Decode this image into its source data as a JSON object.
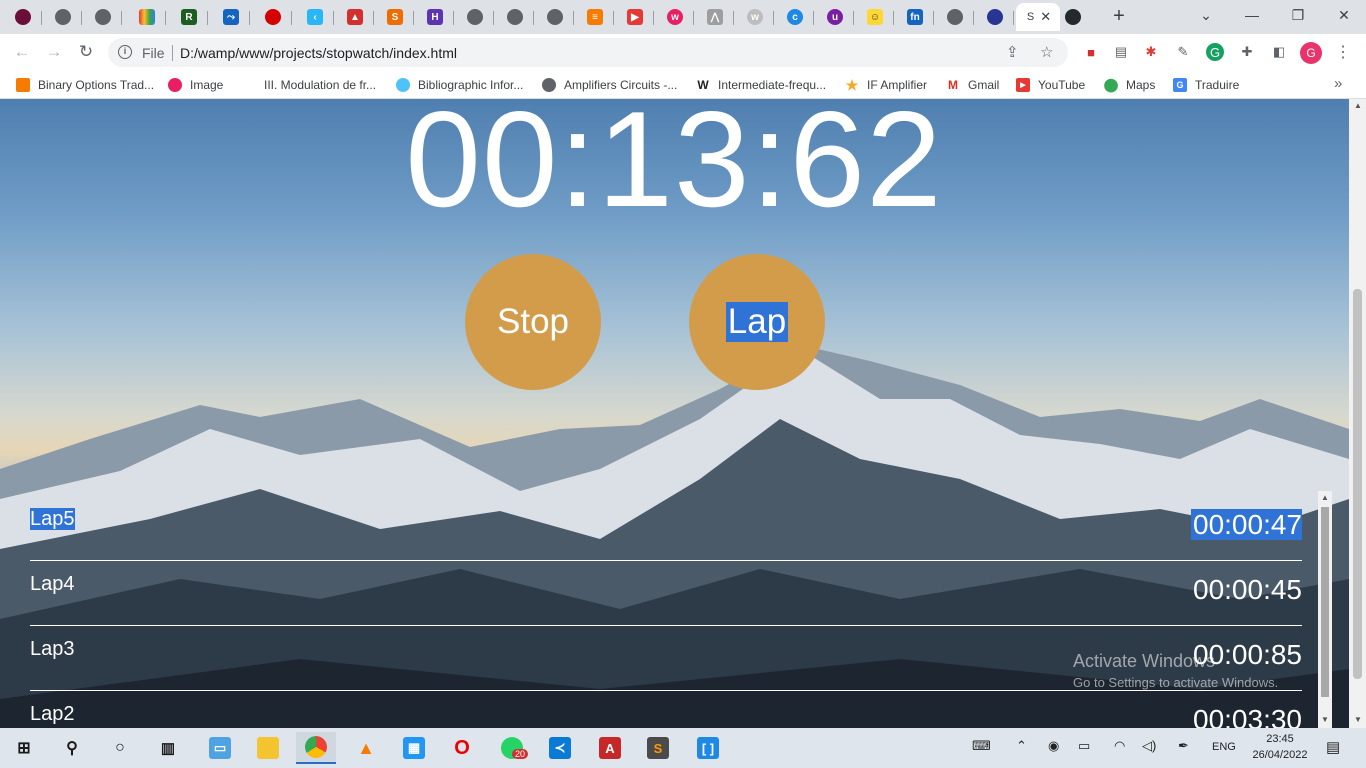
{
  "browser": {
    "active_tab_label": "S",
    "address": {
      "scheme": "File",
      "url": "D:/wamp/www/projects/stopwatch/index.html"
    },
    "profile_initial": "G",
    "bookmarks": [
      {
        "label": "Binary Options Trad...",
        "icon": "cube-icon"
      },
      {
        "label": "Image",
        "icon": "image-icon"
      },
      {
        "label": "III. Modulation de fr...",
        "icon": "blank-icon"
      },
      {
        "label": "Bibliographic Infor...",
        "icon": "cloud-icon"
      },
      {
        "label": "Amplifiers Circuits -...",
        "icon": "globe-icon"
      },
      {
        "label": "Intermediate-frequ...",
        "icon": "wikipedia-icon"
      },
      {
        "label": "IF Amplifier",
        "icon": "star-icon"
      },
      {
        "label": "Gmail",
        "icon": "gmail-icon"
      },
      {
        "label": "YouTube",
        "icon": "youtube-icon"
      },
      {
        "label": "Maps",
        "icon": "maps-icon"
      },
      {
        "label": "Traduire",
        "icon": "translate-icon"
      }
    ]
  },
  "stopwatch": {
    "display": "00:13:62",
    "stop_label": "Stop",
    "lap_label": "Lap",
    "laps": [
      {
        "name": "Lap5",
        "time": "00:00:47"
      },
      {
        "name": "Lap4",
        "time": "00:00:45"
      },
      {
        "name": "Lap3",
        "time": "00:00:85"
      },
      {
        "name": "Lap2",
        "time": "00:03:30"
      }
    ]
  },
  "watermark": {
    "line1": "Activate Windows",
    "line2": "Go to Settings to activate Windows."
  },
  "taskbar": {
    "language": "ENG",
    "time": "23:45",
    "date": "26/04/2022",
    "whatsapp_badge": "20"
  },
  "colors": {
    "button_fill": "#d39c4b",
    "selection": "#2f73d6"
  }
}
